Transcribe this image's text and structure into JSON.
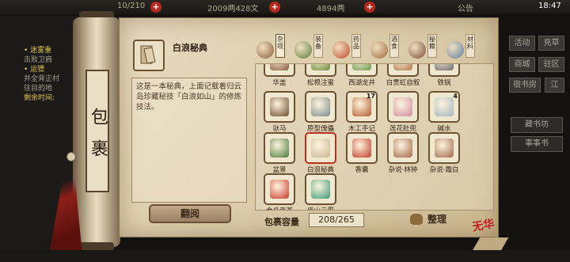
{
  "topbar": {
    "stamina": "10/210",
    "money": "2009两428文",
    "gems": "4894两",
    "notice_label": "公告",
    "time": "18:47"
  },
  "quests": [
    {
      "text": "• 迷雾重",
      "highlight": true
    },
    {
      "text": "击败卫肩",
      "highlight": false
    },
    {
      "text": "• 运镖",
      "highlight": true
    },
    {
      "text": "并全背正村",
      "highlight": false
    },
    {
      "text": "往目的地",
      "highlight": false
    },
    {
      "text": "剩余时间:",
      "highlight": true
    }
  ],
  "right_buttons": [
    "活动",
    "充草",
    "商城",
    "驻区",
    "宿书房",
    "江"
  ],
  "right_panel": [
    "藏书坊",
    "事事书"
  ],
  "bag_label": "包裹",
  "selected_item": {
    "name": "白浪秘典",
    "description": "这是一本秘典，上面记载着归云岛珍藏秘技「白浪如山」的修炼技法。",
    "read_label": "翻阅"
  },
  "tabs": [
    {
      "label": "杂项",
      "color": "#8a5a36"
    },
    {
      "label": "装备",
      "color": "#5c7a3a"
    },
    {
      "label": "药品",
      "color": "#c0462a"
    },
    {
      "label": "酒食",
      "color": "#a0683a"
    },
    {
      "label": "秘籍",
      "color": "#7a4a3a"
    },
    {
      "label": "材料",
      "color": "#5a7ca0"
    }
  ],
  "items": [
    {
      "name": "华盖",
      "count": "",
      "color": "#8a5a3a"
    },
    {
      "name": "松根注蜜",
      "count": "",
      "color": "#6a8a3a"
    },
    {
      "name": "西湖龙井",
      "count": "",
      "color": "#6a9a4a"
    },
    {
      "name": "白贯虹自叙",
      "count": "",
      "color": "#b07a4a"
    },
    {
      "name": "铁锅",
      "count": "",
      "color": "#6a6a6a"
    },
    {
      "name": "驮马",
      "count": "",
      "color": "#6a4a2a"
    },
    {
      "name": "原型傀儡",
      "count": "",
      "color": "#7a8a8a"
    },
    {
      "name": "木工手记",
      "count": "17",
      "color": "#b05a2a"
    },
    {
      "name": "莲花肚兜",
      "count": "",
      "color": "#d08aa0"
    },
    {
      "name": "碱水",
      "count": "4",
      "color": "#a0b4c0"
    },
    {
      "name": "盆景",
      "count": "",
      "color": "#4a7a3a"
    },
    {
      "name": "白浪秘典",
      "count": "",
      "color": "#c8b490"
    },
    {
      "name": "香囊",
      "count": "",
      "color": "#c03a2a"
    },
    {
      "name": "杂说·林钟",
      "count": "",
      "color": "#a0684a"
    },
    {
      "name": "杂说·霜白",
      "count": "",
      "color": "#a0684a"
    },
    {
      "name": "金瓜贡茶",
      "count": "",
      "color": "#c83a2a"
    },
    {
      "name": "庐山云雾",
      "count": "",
      "color": "#3a9a7a"
    }
  ],
  "capacity_label": "包裹容量",
  "capacity_value": "208/265",
  "sort_label": "整理",
  "seal_text": "无华"
}
